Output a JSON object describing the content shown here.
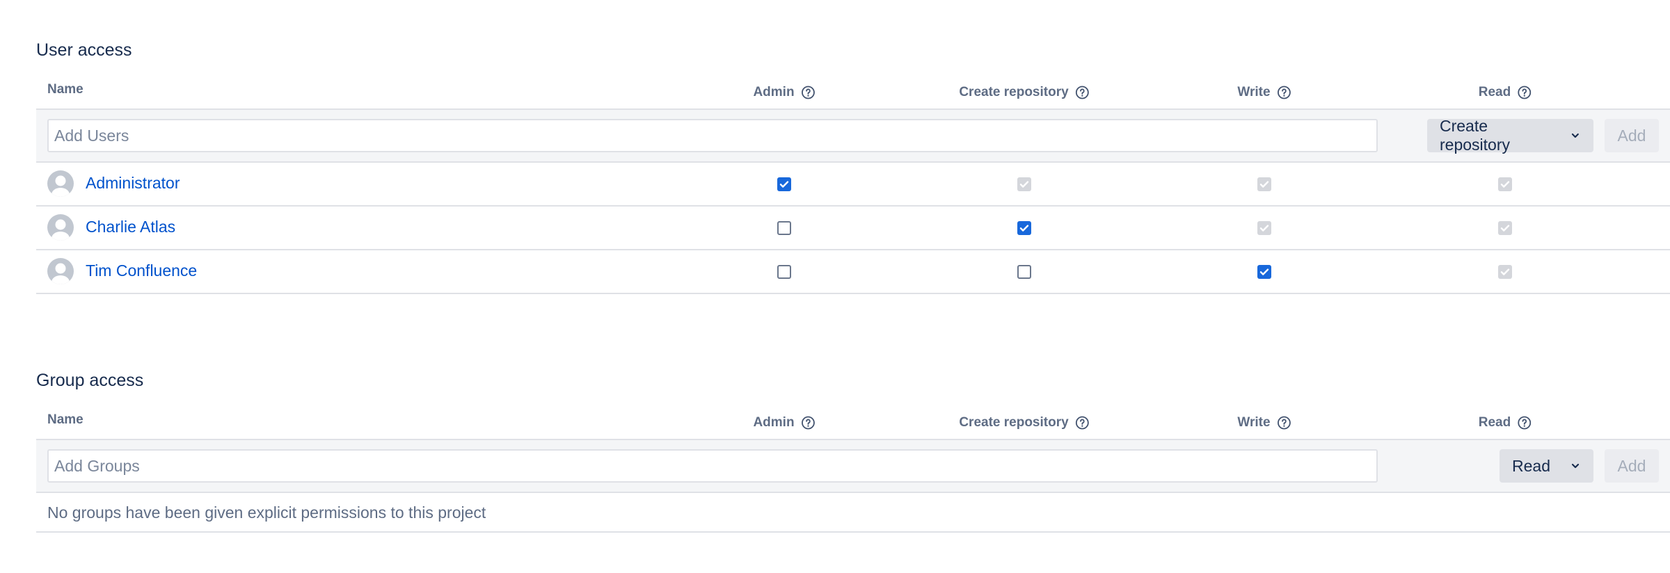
{
  "user_access": {
    "title": "User access",
    "columns": {
      "name": "Name",
      "admin": "Admin",
      "create_repository": "Create repository",
      "write": "Write",
      "read": "Read"
    },
    "add_placeholder": "Add Users",
    "permission_select": "Create repository",
    "add_button": "Add",
    "users": [
      {
        "name": "Administrator",
        "admin": "checked",
        "create_repository": "implied",
        "write": "implied",
        "read": "implied"
      },
      {
        "name": "Charlie Atlas",
        "admin": "unchecked",
        "create_repository": "checked",
        "write": "implied",
        "read": "implied"
      },
      {
        "name": "Tim Confluence",
        "admin": "unchecked",
        "create_repository": "unchecked",
        "write": "checked",
        "read": "implied"
      }
    ]
  },
  "group_access": {
    "title": "Group access",
    "columns": {
      "name": "Name",
      "admin": "Admin",
      "create_repository": "Create repository",
      "write": "Write",
      "read": "Read"
    },
    "add_placeholder": "Add Groups",
    "permission_select": "Read",
    "add_button": "Add",
    "empty_message": "No groups have been given explicit permissions to this project"
  },
  "icons": {
    "help": "help-circle-icon",
    "chevron": "chevron-down-icon",
    "avatar": "default-avatar-icon"
  },
  "colors": {
    "link": "#0052cc",
    "checkbox_checked": "#1868db",
    "checkbox_implied": "#d4d6db",
    "heading": "#172b4d",
    "muted": "#5e6c84"
  }
}
